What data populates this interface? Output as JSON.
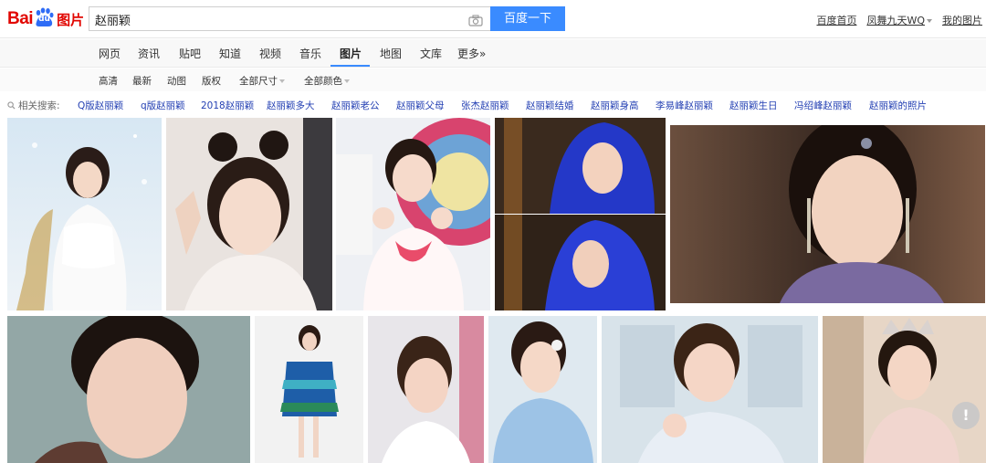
{
  "logo": {
    "bai": "Bai",
    "du": "du",
    "pic": "图片"
  },
  "search": {
    "value": "赵丽颖",
    "button_label": "百度一下"
  },
  "header_links": {
    "home": "百度首页",
    "user": "凤舞九天WQ",
    "my_images": "我的图片"
  },
  "nav": {
    "items": [
      "网页",
      "资讯",
      "贴吧",
      "知道",
      "视频",
      "音乐",
      "图片",
      "地图",
      "文库",
      "更多»"
    ],
    "active": "图片"
  },
  "filters": [
    "高清",
    "最新",
    "动图",
    "版权",
    "全部尺寸",
    "全部颜色"
  ],
  "related": {
    "label": "相关搜索:",
    "items": [
      "Q版赵丽颖",
      "q版赵丽颖",
      "2018赵丽颖",
      "赵丽颖多大",
      "赵丽颖老公",
      "赵丽颖父母",
      "张杰赵丽颖",
      "赵丽颖结婚",
      "赵丽颖身高",
      "李易峰赵丽颖",
      "赵丽颖生日",
      "冯绍峰赵丽颖",
      "赵丽颖的照片"
    ]
  },
  "help_icon": "!",
  "colors": {
    "brand_red": "#e10601",
    "accent_blue": "#3a8bff",
    "link_blue": "#2440b3"
  },
  "icons": [
    "baidu-paw-icon",
    "camera-icon",
    "search-icon",
    "help-icon"
  ]
}
